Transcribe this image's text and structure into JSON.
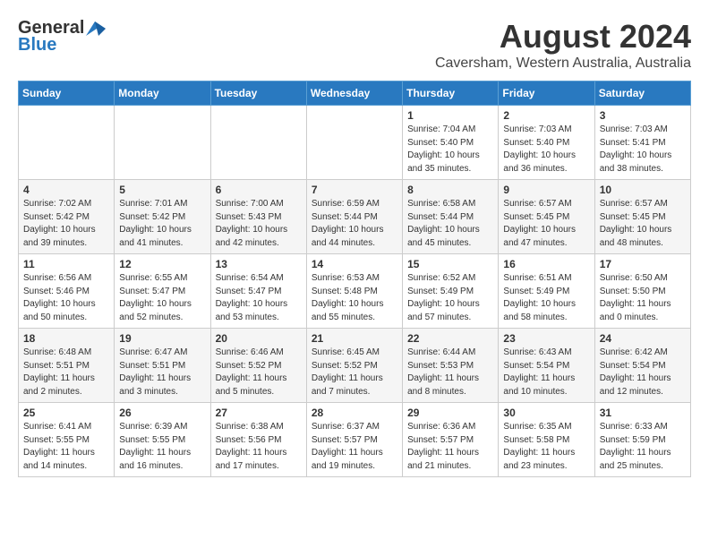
{
  "header": {
    "logo_general": "General",
    "logo_blue": "Blue",
    "month_title": "August 2024",
    "subtitle": "Caversham, Western Australia, Australia"
  },
  "days_of_week": [
    "Sunday",
    "Monday",
    "Tuesday",
    "Wednesday",
    "Thursday",
    "Friday",
    "Saturday"
  ],
  "weeks": [
    [
      {
        "day": "",
        "info": ""
      },
      {
        "day": "",
        "info": ""
      },
      {
        "day": "",
        "info": ""
      },
      {
        "day": "",
        "info": ""
      },
      {
        "day": "1",
        "info": "Sunrise: 7:04 AM\nSunset: 5:40 PM\nDaylight: 10 hours\nand 35 minutes."
      },
      {
        "day": "2",
        "info": "Sunrise: 7:03 AM\nSunset: 5:40 PM\nDaylight: 10 hours\nand 36 minutes."
      },
      {
        "day": "3",
        "info": "Sunrise: 7:03 AM\nSunset: 5:41 PM\nDaylight: 10 hours\nand 38 minutes."
      }
    ],
    [
      {
        "day": "4",
        "info": "Sunrise: 7:02 AM\nSunset: 5:42 PM\nDaylight: 10 hours\nand 39 minutes."
      },
      {
        "day": "5",
        "info": "Sunrise: 7:01 AM\nSunset: 5:42 PM\nDaylight: 10 hours\nand 41 minutes."
      },
      {
        "day": "6",
        "info": "Sunrise: 7:00 AM\nSunset: 5:43 PM\nDaylight: 10 hours\nand 42 minutes."
      },
      {
        "day": "7",
        "info": "Sunrise: 6:59 AM\nSunset: 5:44 PM\nDaylight: 10 hours\nand 44 minutes."
      },
      {
        "day": "8",
        "info": "Sunrise: 6:58 AM\nSunset: 5:44 PM\nDaylight: 10 hours\nand 45 minutes."
      },
      {
        "day": "9",
        "info": "Sunrise: 6:57 AM\nSunset: 5:45 PM\nDaylight: 10 hours\nand 47 minutes."
      },
      {
        "day": "10",
        "info": "Sunrise: 6:57 AM\nSunset: 5:45 PM\nDaylight: 10 hours\nand 48 minutes."
      }
    ],
    [
      {
        "day": "11",
        "info": "Sunrise: 6:56 AM\nSunset: 5:46 PM\nDaylight: 10 hours\nand 50 minutes."
      },
      {
        "day": "12",
        "info": "Sunrise: 6:55 AM\nSunset: 5:47 PM\nDaylight: 10 hours\nand 52 minutes."
      },
      {
        "day": "13",
        "info": "Sunrise: 6:54 AM\nSunset: 5:47 PM\nDaylight: 10 hours\nand 53 minutes."
      },
      {
        "day": "14",
        "info": "Sunrise: 6:53 AM\nSunset: 5:48 PM\nDaylight: 10 hours\nand 55 minutes."
      },
      {
        "day": "15",
        "info": "Sunrise: 6:52 AM\nSunset: 5:49 PM\nDaylight: 10 hours\nand 57 minutes."
      },
      {
        "day": "16",
        "info": "Sunrise: 6:51 AM\nSunset: 5:49 PM\nDaylight: 10 hours\nand 58 minutes."
      },
      {
        "day": "17",
        "info": "Sunrise: 6:50 AM\nSunset: 5:50 PM\nDaylight: 11 hours\nand 0 minutes."
      }
    ],
    [
      {
        "day": "18",
        "info": "Sunrise: 6:48 AM\nSunset: 5:51 PM\nDaylight: 11 hours\nand 2 minutes."
      },
      {
        "day": "19",
        "info": "Sunrise: 6:47 AM\nSunset: 5:51 PM\nDaylight: 11 hours\nand 3 minutes."
      },
      {
        "day": "20",
        "info": "Sunrise: 6:46 AM\nSunset: 5:52 PM\nDaylight: 11 hours\nand 5 minutes."
      },
      {
        "day": "21",
        "info": "Sunrise: 6:45 AM\nSunset: 5:52 PM\nDaylight: 11 hours\nand 7 minutes."
      },
      {
        "day": "22",
        "info": "Sunrise: 6:44 AM\nSunset: 5:53 PM\nDaylight: 11 hours\nand 8 minutes."
      },
      {
        "day": "23",
        "info": "Sunrise: 6:43 AM\nSunset: 5:54 PM\nDaylight: 11 hours\nand 10 minutes."
      },
      {
        "day": "24",
        "info": "Sunrise: 6:42 AM\nSunset: 5:54 PM\nDaylight: 11 hours\nand 12 minutes."
      }
    ],
    [
      {
        "day": "25",
        "info": "Sunrise: 6:41 AM\nSunset: 5:55 PM\nDaylight: 11 hours\nand 14 minutes."
      },
      {
        "day": "26",
        "info": "Sunrise: 6:39 AM\nSunset: 5:55 PM\nDaylight: 11 hours\nand 16 minutes."
      },
      {
        "day": "27",
        "info": "Sunrise: 6:38 AM\nSunset: 5:56 PM\nDaylight: 11 hours\nand 17 minutes."
      },
      {
        "day": "28",
        "info": "Sunrise: 6:37 AM\nSunset: 5:57 PM\nDaylight: 11 hours\nand 19 minutes."
      },
      {
        "day": "29",
        "info": "Sunrise: 6:36 AM\nSunset: 5:57 PM\nDaylight: 11 hours\nand 21 minutes."
      },
      {
        "day": "30",
        "info": "Sunrise: 6:35 AM\nSunset: 5:58 PM\nDaylight: 11 hours\nand 23 minutes."
      },
      {
        "day": "31",
        "info": "Sunrise: 6:33 AM\nSunset: 5:59 PM\nDaylight: 11 hours\nand 25 minutes."
      }
    ]
  ]
}
